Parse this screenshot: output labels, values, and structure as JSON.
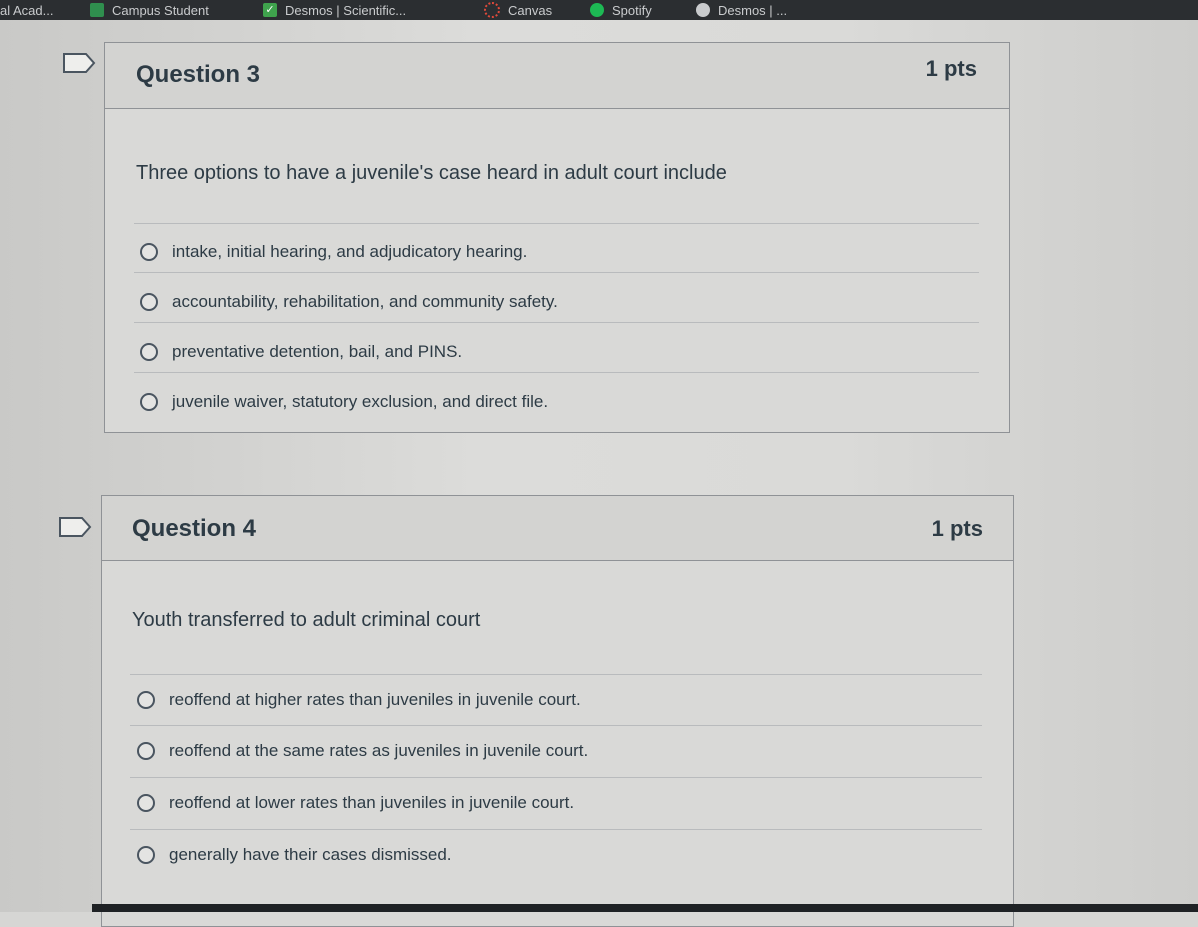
{
  "bookmarks": [
    {
      "label": "al Acad...",
      "icon": "bookmark-icon",
      "color": "#c9cbcd"
    },
    {
      "label": "Campus Student",
      "icon": "campus-icon",
      "color": "#2f8f4e"
    },
    {
      "label": "Desmos | Scientific...",
      "icon": "check-icon",
      "color": "#3fa34d"
    },
    {
      "label": "Canvas",
      "icon": "canvas-icon",
      "color": "#e04a3b"
    },
    {
      "label": "Spotify",
      "icon": "spotify-icon",
      "color": "#1db954"
    },
    {
      "label": "Desmos | ...",
      "icon": "desmos-icon",
      "color": "#c9cbcd"
    }
  ],
  "questions": [
    {
      "title": "Question 3",
      "points": "1 pts",
      "text": "Three options to have a juvenile's case heard in adult court include",
      "answers": [
        "intake, initial hearing, and adjudicatory hearing.",
        "accountability, rehabilitation, and community safety.",
        "preventative detention, bail, and PINS.",
        "juvenile waiver, statutory exclusion, and direct file."
      ]
    },
    {
      "title": "Question 4",
      "points": "1 pts",
      "text": "Youth transferred to adult criminal court",
      "answers": [
        "reoffend at higher rates than juveniles in juvenile court.",
        "reoffend at the same rates as juveniles in juvenile court.",
        "reoffend at lower rates than juveniles in juvenile court.",
        "generally have their cases dismissed."
      ]
    }
  ],
  "colors": {
    "text": "#2d3b45",
    "border": "#8f9296",
    "background": "#d9d9d7"
  }
}
